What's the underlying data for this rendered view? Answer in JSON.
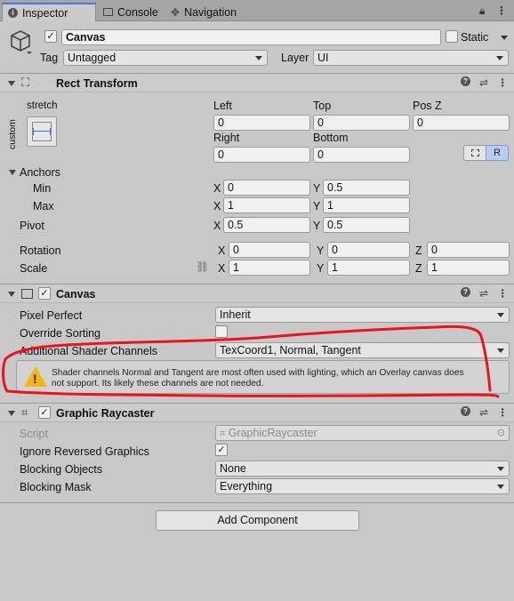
{
  "tabs": [
    {
      "label": "Inspector",
      "active": true,
      "icon": "info-icon"
    },
    {
      "label": "Console",
      "active": false,
      "icon": "console-icon"
    },
    {
      "label": "Navigation",
      "active": false,
      "icon": "navigation-icon"
    }
  ],
  "object": {
    "name": "Canvas",
    "active_checked": true,
    "static_label": "Static",
    "static_checked": false,
    "tag_label": "Tag",
    "tag_value": "Untagged",
    "layer_label": "Layer",
    "layer_value": "UI"
  },
  "rect_transform": {
    "title": "Rect Transform",
    "anchor_preset_top": "stretch",
    "anchor_preset_side": "custom",
    "left_label": "Left",
    "left_value": "0",
    "top_label": "Top",
    "top_value": "0",
    "posz_label": "Pos Z",
    "posz_value": "0",
    "right_label": "Right",
    "right_value": "0",
    "bottom_label": "Bottom",
    "bottom_value": "0",
    "r_button": "R",
    "anchors_label": "Anchors",
    "min_label": "Min",
    "min_x": "0",
    "min_y": "0.5",
    "max_label": "Max",
    "max_x": "1",
    "max_y": "1",
    "pivot_label": "Pivot",
    "pivot_x": "0.5",
    "pivot_y": "0.5",
    "rotation_label": "Rotation",
    "rot_x": "0",
    "rot_y": "0",
    "rot_z": "0",
    "scale_label": "Scale",
    "scale_x": "1",
    "scale_y": "1",
    "scale_z": "1",
    "x": "X",
    "y": "Y",
    "z": "Z"
  },
  "canvas": {
    "title": "Canvas",
    "enabled": true,
    "pixel_perfect_label": "Pixel Perfect",
    "pixel_perfect_value": "Inherit",
    "override_sorting_label": "Override Sorting",
    "override_sorting_checked": false,
    "shader_channels_label": "Additional Shader Channels",
    "shader_channels_value": "TexCoord1, Normal, Tangent",
    "warning_line1": "Shader channels Normal and Tangent are most often used with lighting, which an Overlay canvas does",
    "warning_line2": "not support. Its likely these channels are not needed."
  },
  "graphic_raycaster": {
    "title": "Graphic Raycaster",
    "enabled": true,
    "script_label": "Script",
    "script_value": "GraphicRaycaster",
    "ignore_reversed_label": "Ignore Reversed Graphics",
    "ignore_reversed_checked": true,
    "blocking_objects_label": "Blocking Objects",
    "blocking_objects_value": "None",
    "blocking_mask_label": "Blocking Mask",
    "blocking_mask_value": "Everything"
  },
  "add_component_label": "Add Component",
  "colors": {
    "annotation": "#e8141e",
    "warning": "#f5b514",
    "tab_accent": "#4a7ad8"
  }
}
